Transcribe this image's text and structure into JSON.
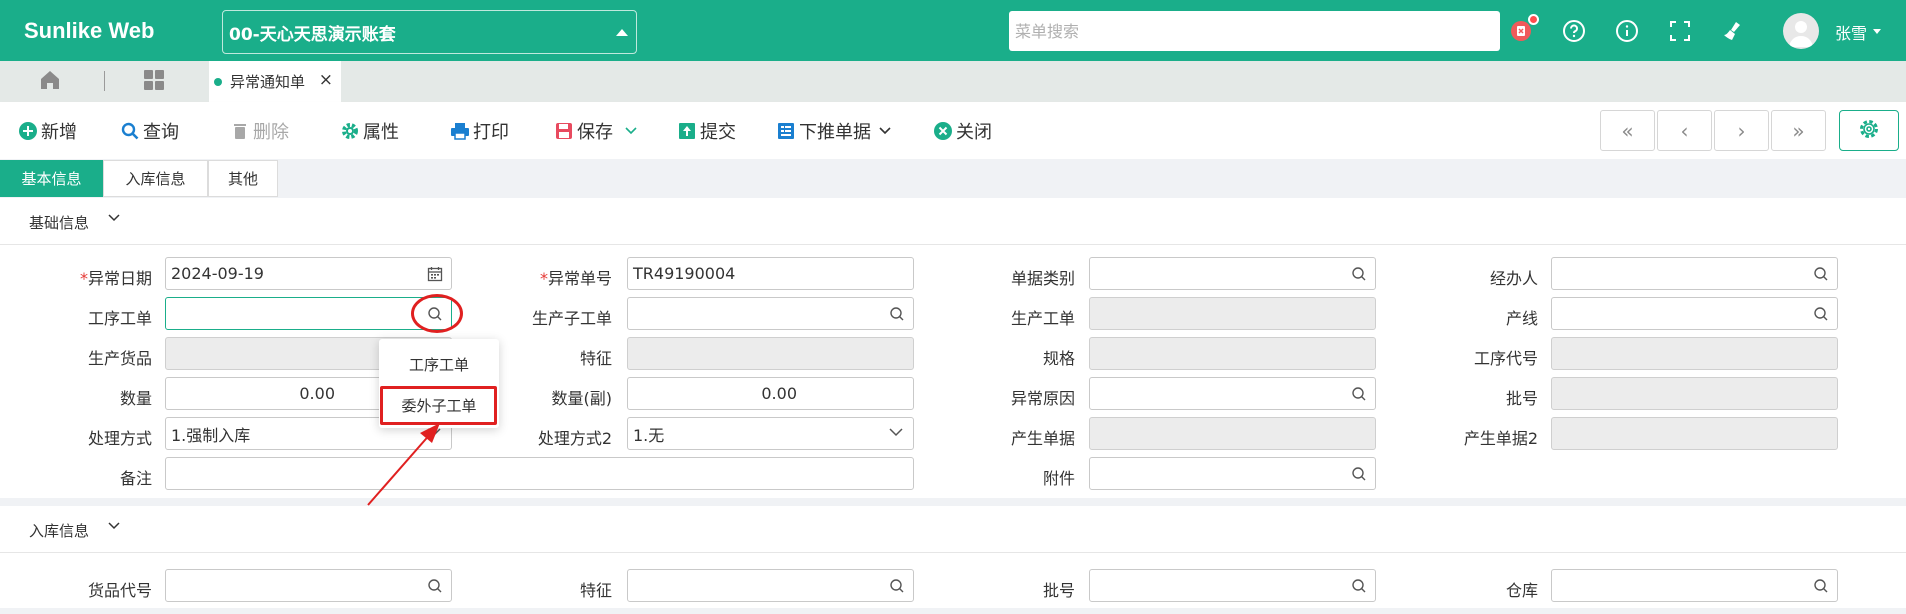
{
  "header": {
    "brand": "Sunlike Web",
    "account": "00-天心天思演示账套",
    "search_placeholder": "菜单搜索",
    "user_name": "张雪",
    "icons": [
      "task-icon",
      "help-icon",
      "info-icon",
      "fullscreen-icon",
      "clean-icon"
    ]
  },
  "tabstrip": {
    "doc_tab": "异常通知单"
  },
  "toolbar": {
    "new": "新增",
    "query": "查询",
    "delete": "删除",
    "properties": "属性",
    "print": "打印",
    "save": "保存",
    "submit": "提交",
    "push_down": "下推单据",
    "close": "关闭",
    "pager": [
      "«",
      "‹",
      "›",
      "»"
    ]
  },
  "section_tabs": [
    "基本信息",
    "入库信息",
    "其他"
  ],
  "basic": {
    "title": "基础信息",
    "labels": {
      "date": "异常日期",
      "no": "异常单号",
      "doc_type": "单据类别",
      "handler": "经办人",
      "proc_order": "工序工单",
      "prod_sub_order": "生产子工单",
      "prod_order": "生产工单",
      "line": "产线",
      "prod_goods": "生产货品",
      "feature": "特征",
      "spec": "规格",
      "proc_code": "工序代号",
      "qty": "数量",
      "qty_sub": "数量(副)",
      "reason": "异常原因",
      "batch": "批号",
      "method": "处理方式",
      "method2": "处理方式2",
      "gen_doc": "产生单据",
      "gen_doc2": "产生单据2",
      "remark": "备注",
      "attach": "附件"
    },
    "values": {
      "date": "2024-09-19",
      "no": "TR49190004",
      "qty": "0.00",
      "qty_sub": "0.00",
      "method": "1.强制入库",
      "method2": "1.无"
    }
  },
  "popup": {
    "options": [
      "工序工单",
      "委外子工单"
    ]
  },
  "stock": {
    "title": "入库信息",
    "labels": {
      "goods_code": "货品代号",
      "feature": "特征",
      "batch": "批号",
      "warehouse": "仓库"
    }
  },
  "colors": {
    "brand": "#1aae8a",
    "highlight": "#e02020"
  }
}
